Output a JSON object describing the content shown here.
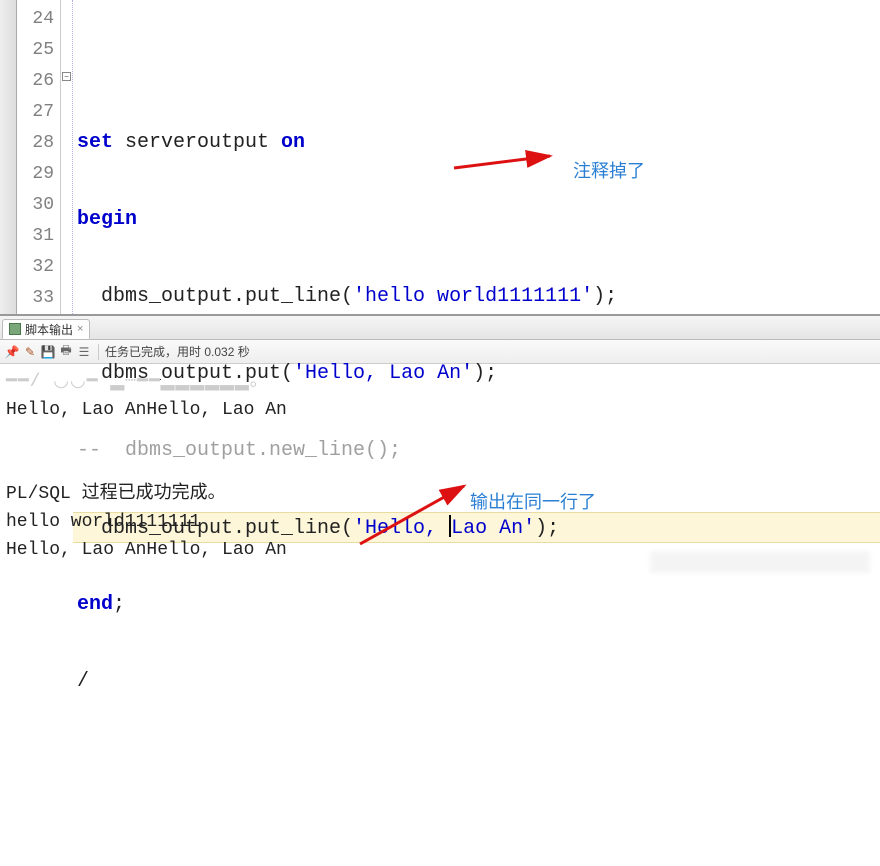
{
  "editor": {
    "line_numbers": [
      "24",
      "25",
      "26",
      "27",
      "28",
      "29",
      "30",
      "31",
      "32",
      "33"
    ],
    "lines": {
      "l25_kw": "set",
      "l25_rest": " serveroutput ",
      "l25_on": "on",
      "l26_kw": "begin",
      "l27": "  dbms_output.put_line(",
      "l27_str": "'hello world1111111'",
      "l27_end": ");",
      "l28": "  dbms_output.put(",
      "l28_str": "'Hello, Lao An'",
      "l28_end": ");",
      "l29_cmt": "--  dbms_output.new_line();",
      "l30": "  dbms_output.put_line(",
      "l30_str_a": "'Hello, ",
      "l30_str_b": "Lao An'",
      "l30_end": ");",
      "l31_kw": "end",
      "l31_semi": ";",
      "l32": "/"
    },
    "annotation1": "注释掉了"
  },
  "output": {
    "tab_title": "脚本输出",
    "status_text": "任务已完成，用时 0.032 秒",
    "body_line0": "━━/ ◡◡━ ▂┈━━▂▂▂▂▂▂。",
    "body_line1": "Hello, Lao AnHello, Lao An",
    "body_blank": "",
    "body_line2": "PL/SQL 过程已成功完成。",
    "body_line3": "hello world1111111",
    "body_line4": "Hello, Lao AnHello, Lao An",
    "annotation2": "输出在同一行了"
  },
  "icons": {
    "pin": "📌",
    "pencil": "✎",
    "save": "💾",
    "print": "🖶",
    "text": "☰"
  }
}
